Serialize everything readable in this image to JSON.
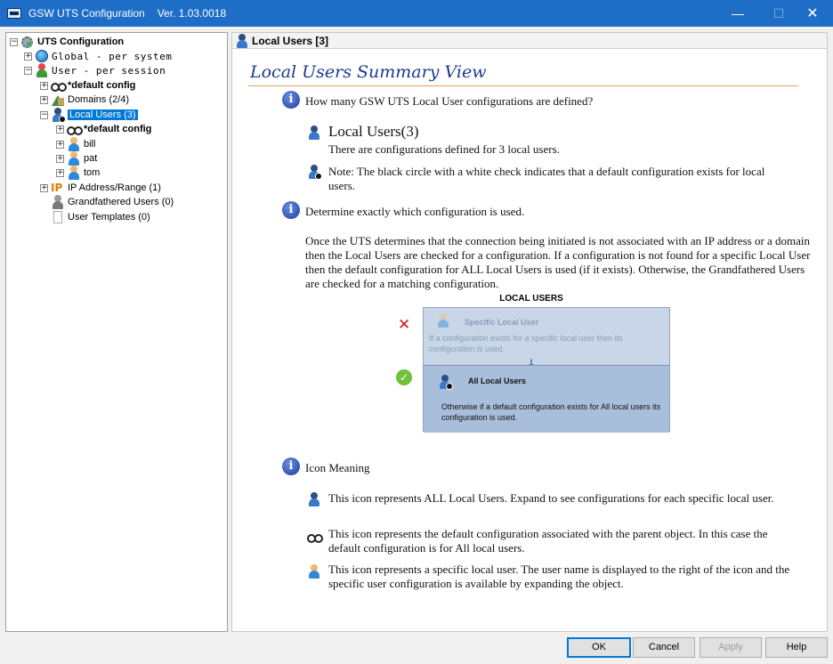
{
  "window": {
    "title": "GSW UTS Configuration",
    "version": "Ver. 1.03.0018",
    "minimize_glyph": "—",
    "maximize_glyph": "☐",
    "close_glyph": "✕"
  },
  "tree": {
    "expanded_glyph": "−",
    "collapsed_glyph": "+",
    "root": "UTS Configuration",
    "global": "Global  - per system",
    "user": "User    - per session",
    "default_config": "*default config",
    "domains": "Domains (2/4)",
    "local_users": "Local Users (3)",
    "local_default_config": "*default config",
    "users": [
      "bill",
      "pat",
      "tom"
    ],
    "ip_label": "IP",
    "ip_range": "IP Address/Range (1)",
    "grandfathered": "Grandfathered Users (0)",
    "user_templates": "User Templates (0)"
  },
  "detail": {
    "header": "Local Users [3]",
    "summary_title": "Local Users Summary View",
    "info_glyph": "i",
    "q1": "How many GSW UTS Local User configurations are defined?",
    "count_title": "Local Users(3)",
    "count_text": "There are configurations defined for 3 local users.",
    "note": "Note: The black circle with a white check indicates that a default configuration exists for local users.",
    "q2": "Determine exactly which configuration is used.",
    "paragraph": "Once the UTS determines that the connection being initiated is not associated with an IP address or a domain then the Local Users are checked for a configuration. If a configuration is not found for a specific Local User then the default configuration for ALL Local Users is used (if it exists). Otherwise, the Grandfathered Users are checked for a matching configuration.",
    "diagram": {
      "title": "LOCAL USERS",
      "specific_label": "Specific Local User",
      "specific_text": "If a configuration exists for a specific local user then its configuration is used.",
      "all_label": "All Local Users",
      "all_text": "Otherwise if a default configuration exists for All local users its configuration is used.",
      "x_glyph": "✕",
      "check_glyph": "✓",
      "arrow_glyph": "↓"
    },
    "icon_meaning": "Icon Meaning",
    "icon_all": "This icon represents ALL Local Users. Expand to see configurations for each specific local user.",
    "icon_default": "This icon represents the default configuration associated with the parent object. In this case the default configuration is for All local users.",
    "icon_specific": "This icon represents a specific local user. The user name is displayed to the right of the icon and the specific user configuration is available by expanding the object."
  },
  "buttons": {
    "ok": "OK",
    "cancel": "Cancel",
    "apply": "Apply",
    "help": "Help"
  }
}
